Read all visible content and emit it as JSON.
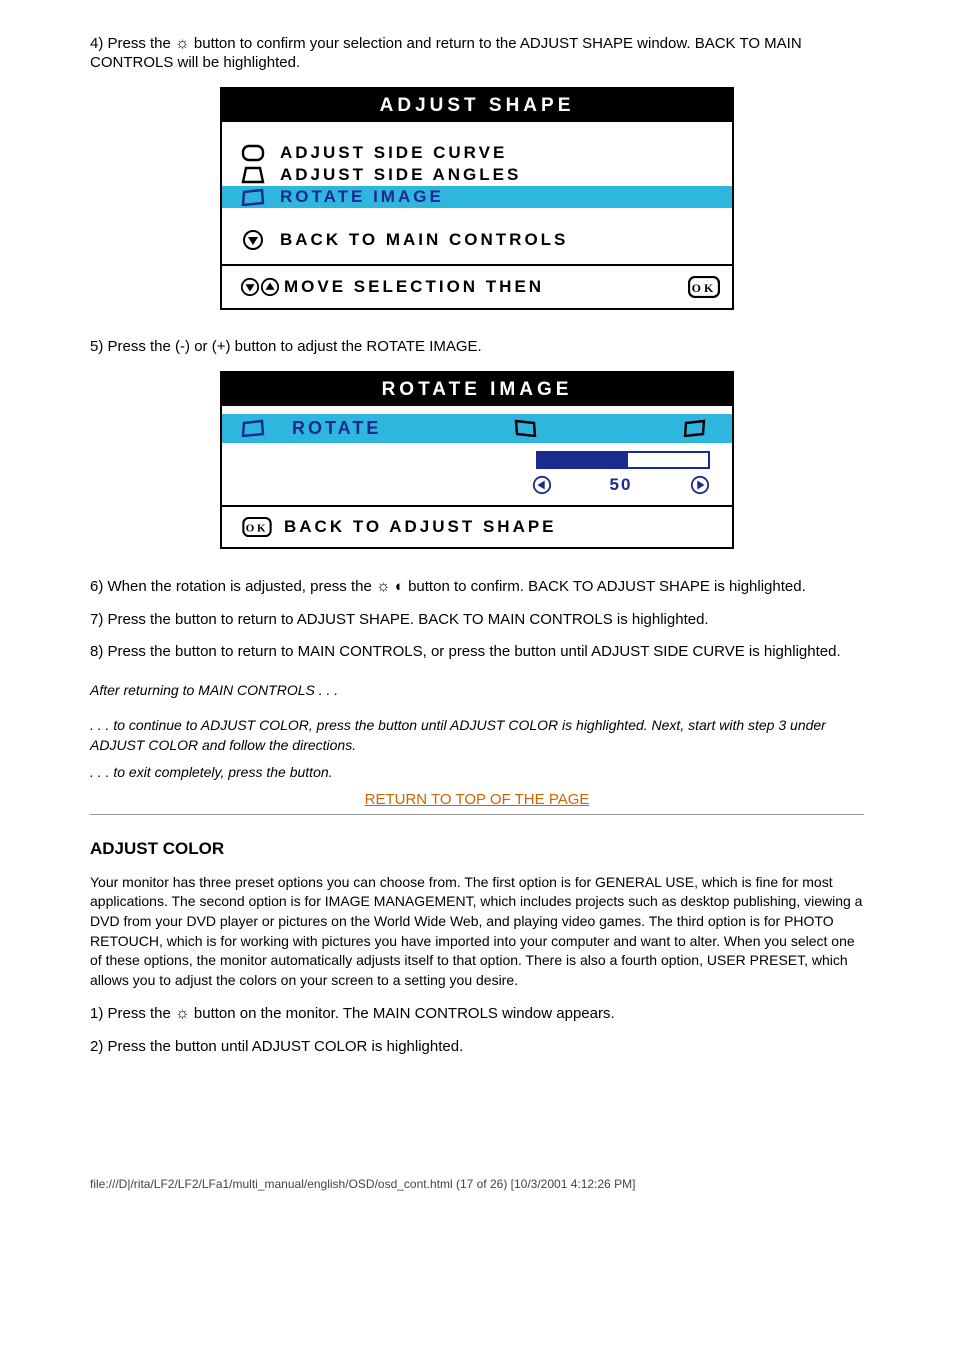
{
  "steps": {
    "s4": "4) Press the ",
    "s4b": " button to confirm your selection and return to the ADJUST SHAPE window. BACK TO MAIN CONTROLS will be highlighted.",
    "s5": "5) Press the ",
    "s5b": " or ",
    "s5c": " button to adjust the ROTATE IMAGE.",
    "s6": "6) When the rotation is adjusted, press the ",
    "s6b": " button to confirm. BACK TO ADJUST SHAPE is highlighted.",
    "s7": "7) Press the ",
    "s7b": " button to return to ADJUST SHAPE. BACK TO MAIN CONTROLS  is highlighted.",
    "s8": "8) Press the ",
    "s8b": " button to return to MAIN CONTROLS, or press the ",
    "s8c": " button until ADJUST SIDE CURVE is highlighted."
  },
  "note": "After returning to MAIN CONTROLS . . .",
  "note2a": ". . . to continue to ADJUST COLOR,  press the ",
  "note2b": " button until ADJUST COLOR is highlighted. Next, start with step 3 under ADJUST COLOR and follow the directions.",
  "note3a": ". . . to exit completely, press the ",
  "note3b": " button.",
  "toplink": "RETURN TO TOP OF THE PAGE",
  "osd1": {
    "title": "ADJUST SHAPE",
    "items": [
      "ADJUST SIDE CURVE",
      "ADJUST SIDE ANGLES",
      "ROTATE IMAGE"
    ],
    "back": "BACK TO MAIN CONTROLS",
    "foot": "MOVE SELECTION THEN"
  },
  "osd2": {
    "title": "ROTATE IMAGE",
    "label": "ROTATE",
    "value": "50",
    "back": "BACK TO ADJUST SHAPE"
  },
  "color": {
    "heading": "ADJUST COLOR",
    "p1": "Your monitor has three preset options you can choose from. The first option is for GENERAL USE, which is fine for most applications. The second option is for IMAGE MANAGEMENT, which includes projects such as desktop publishing, viewing a DVD from your DVD player or pictures on the World Wide Web, and playing video games. The third option is for PHOTO RETOUCH, which is for working with pictures you have imported into your computer and want to alter. When you select one of these options, the monitor automatically adjusts itself to that option. There is also a fourth option, USER PRESET, which allows you to adjust the colors on your screen to a setting you desire.",
    "s1a": "1) Press the ",
    "s1b": " button on the monitor. The MAIN CONTROLS window appears.",
    "s2a": "2) Press the ",
    "s2b": " button until ADJUST COLOR is highlighted."
  },
  "footer": "file:///D|/rita/LF2/LF2/LFa1/multi_manual/english/OSD/osd_cont.html (17 of 26) [10/3/2001 4:12:26 PM]"
}
